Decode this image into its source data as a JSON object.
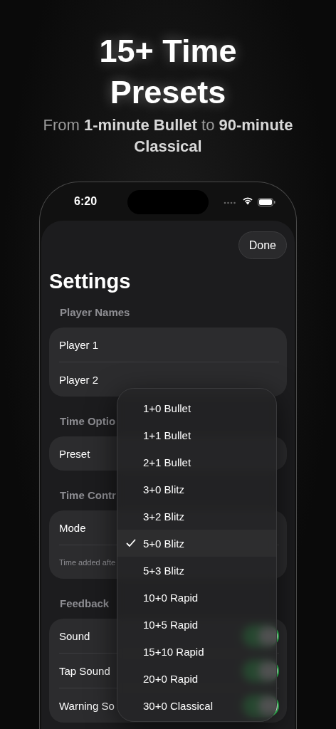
{
  "headline": {
    "title": "15+ Time Presets",
    "subtitle": "From **1-minute Bullet** to **90-minute Classical**"
  },
  "status_bar": {
    "time": "6:20"
  },
  "done_button": "Done",
  "title": "Settings",
  "sections": [
    {
      "header": "Player Names",
      "rows": [
        {
          "kind": "field",
          "label": "Player 1"
        },
        {
          "kind": "field",
          "label": "Player 2"
        }
      ]
    },
    {
      "header": "Time Optio",
      "rows": [
        {
          "kind": "picker",
          "label": "Preset"
        }
      ]
    },
    {
      "header": "Time Contr",
      "rows": [
        {
          "kind": "picker",
          "label": "Mode"
        },
        {
          "kind": "note",
          "label": "Time added afte"
        }
      ]
    },
    {
      "header": "Feedback",
      "rows": [
        {
          "kind": "toggle",
          "label": "Sound",
          "on": true
        },
        {
          "kind": "toggle",
          "label": "Tap Sound",
          "on": true
        },
        {
          "kind": "toggle",
          "label": "Warning So",
          "on": true
        }
      ]
    }
  ],
  "menu": {
    "items": [
      {
        "label": "1+0 Bullet",
        "selected": false
      },
      {
        "label": "1+1 Bullet",
        "selected": false
      },
      {
        "label": "2+1 Bullet",
        "selected": false
      },
      {
        "label": "3+0 Blitz",
        "selected": false
      },
      {
        "label": "3+2 Blitz",
        "selected": false
      },
      {
        "label": "5+0 Blitz",
        "selected": true
      },
      {
        "label": "5+3 Blitz",
        "selected": false
      },
      {
        "label": "10+0 Rapid",
        "selected": false
      },
      {
        "label": "10+5 Rapid",
        "selected": false
      },
      {
        "label": "15+10 Rapid",
        "selected": false
      },
      {
        "label": "20+0 Rapid",
        "selected": false
      },
      {
        "label": "30+0 Classical",
        "selected": false
      }
    ]
  }
}
